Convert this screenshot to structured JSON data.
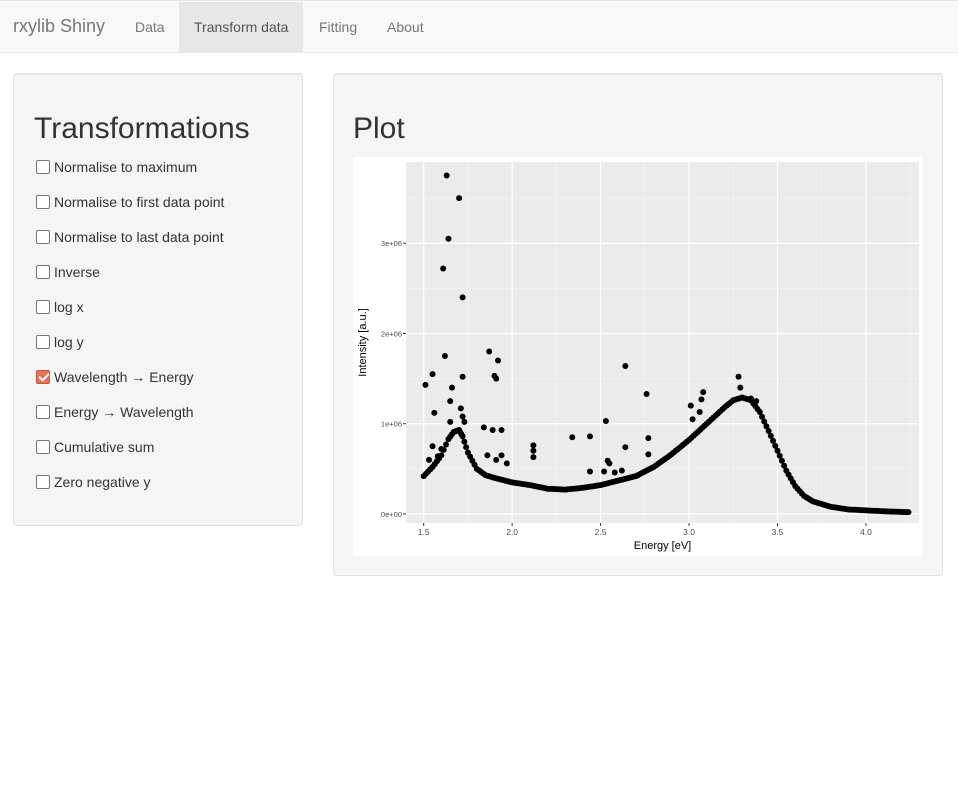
{
  "navbar": {
    "brand": "rxylib Shiny",
    "tabs": [
      {
        "label": "Data",
        "active": false
      },
      {
        "label": "Transform data",
        "active": true
      },
      {
        "label": "Fitting",
        "active": false
      },
      {
        "label": "About",
        "active": false
      }
    ]
  },
  "sidebar": {
    "title": "Transformations",
    "options": [
      {
        "label": "Normalise to maximum",
        "checked": false
      },
      {
        "label": "Normalise to first data point",
        "checked": false
      },
      {
        "label": "Normalise to last data point",
        "checked": false
      },
      {
        "label": "Inverse",
        "checked": false
      },
      {
        "label": "log x",
        "checked": false
      },
      {
        "label": "log y",
        "checked": false
      },
      {
        "label": "Wavelength → Energy",
        "checked": true
      },
      {
        "label": "Energy → Wavelength",
        "checked": false
      },
      {
        "label": "Cumulative sum",
        "checked": false
      },
      {
        "label": "Zero negative y",
        "checked": false
      }
    ]
  },
  "main": {
    "title": "Plot"
  },
  "colors": {
    "accent_checkbox": "#e5735a",
    "panel_bg": "#ebebeb",
    "points": "#000000"
  },
  "chart_data": {
    "type": "scatter",
    "xlabel": "Energy [eV]",
    "ylabel": "Intensity [a.u.]",
    "xlim": [
      1.4,
      4.3
    ],
    "ylim": [
      -100000,
      3900000
    ],
    "x_ticks": [
      1.5,
      2.0,
      2.5,
      3.0,
      3.5,
      4.0
    ],
    "x_tick_labels": [
      "1.5",
      "2.0",
      "2.5",
      "3.0",
      "3.5",
      "4.0"
    ],
    "y_ticks": [
      0,
      1000000,
      2000000,
      3000000
    ],
    "y_tick_labels": [
      "0e+00",
      "1e+06",
      "2e+06",
      "3e+06"
    ],
    "grid": true,
    "baseline_points": [
      [
        1.5,
        420000
      ],
      [
        1.55,
        520000
      ],
      [
        1.6,
        650000
      ],
      [
        1.64,
        830000
      ],
      [
        1.67,
        910000
      ],
      [
        1.7,
        930000
      ],
      [
        1.72,
        860000
      ],
      [
        1.75,
        680000
      ],
      [
        1.8,
        500000
      ],
      [
        1.85,
        430000
      ],
      [
        1.9,
        400000
      ],
      [
        2.0,
        350000
      ],
      [
        2.1,
        320000
      ],
      [
        2.2,
        280000
      ],
      [
        2.3,
        270000
      ],
      [
        2.4,
        290000
      ],
      [
        2.5,
        320000
      ],
      [
        2.6,
        370000
      ],
      [
        2.7,
        420000
      ],
      [
        2.8,
        520000
      ],
      [
        2.9,
        660000
      ],
      [
        3.0,
        820000
      ],
      [
        3.1,
        1000000
      ],
      [
        3.2,
        1180000
      ],
      [
        3.25,
        1260000
      ],
      [
        3.3,
        1290000
      ],
      [
        3.35,
        1260000
      ],
      [
        3.4,
        1130000
      ],
      [
        3.45,
        920000
      ],
      [
        3.5,
        700000
      ],
      [
        3.55,
        480000
      ],
      [
        3.6,
        310000
      ],
      [
        3.65,
        200000
      ],
      [
        3.7,
        140000
      ],
      [
        3.8,
        80000
      ],
      [
        3.9,
        50000
      ],
      [
        4.0,
        40000
      ],
      [
        4.1,
        30000
      ],
      [
        4.24,
        20000
      ]
    ],
    "outliers": [
      [
        1.63,
        3750000
      ],
      [
        1.7,
        3500000
      ],
      [
        1.64,
        3050000
      ],
      [
        1.61,
        2720000
      ],
      [
        1.72,
        2400000
      ],
      [
        1.62,
        1750000
      ],
      [
        1.51,
        1430000
      ],
      [
        1.55,
        1550000
      ],
      [
        1.66,
        1400000
      ],
      [
        1.72,
        1520000
      ],
      [
        1.65,
        1250000
      ],
      [
        1.56,
        1120000
      ],
      [
        1.71,
        1170000
      ],
      [
        1.72,
        1080000
      ],
      [
        1.73,
        1020000
      ],
      [
        1.65,
        1020000
      ],
      [
        1.53,
        600000
      ],
      [
        1.55,
        750000
      ],
      [
        1.58,
        640000
      ],
      [
        1.6,
        720000
      ],
      [
        1.87,
        1800000
      ],
      [
        1.92,
        1700000
      ],
      [
        1.9,
        1530000
      ],
      [
        1.91,
        1500000
      ],
      [
        1.84,
        960000
      ],
      [
        1.89,
        930000
      ],
      [
        1.94,
        930000
      ],
      [
        1.86,
        650000
      ],
      [
        1.91,
        600000
      ],
      [
        1.94,
        650000
      ],
      [
        1.97,
        560000
      ],
      [
        2.12,
        760000
      ],
      [
        2.12,
        700000
      ],
      [
        2.12,
        630000
      ],
      [
        2.34,
        850000
      ],
      [
        2.44,
        860000
      ],
      [
        2.53,
        1030000
      ],
      [
        2.54,
        590000
      ],
      [
        2.55,
        560000
      ],
      [
        2.58,
        460000
      ],
      [
        2.62,
        480000
      ],
      [
        2.64,
        740000
      ],
      [
        2.64,
        1640000
      ],
      [
        2.76,
        1330000
      ],
      [
        2.77,
        840000
      ],
      [
        2.77,
        660000
      ],
      [
        2.52,
        470000
      ],
      [
        2.44,
        470000
      ],
      [
        3.01,
        1200000
      ],
      [
        3.02,
        1050000
      ],
      [
        3.06,
        1130000
      ],
      [
        3.07,
        1270000
      ],
      [
        3.08,
        1350000
      ],
      [
        3.28,
        1520000
      ],
      [
        3.29,
        1400000
      ],
      [
        3.35,
        1280000
      ],
      [
        3.38,
        1250000
      ]
    ]
  }
}
